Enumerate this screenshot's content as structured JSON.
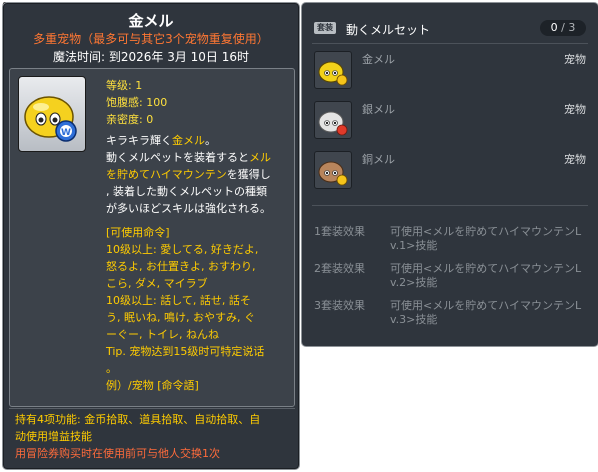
{
  "corner": {
    "id": "05002809",
    "tag": "新增"
  },
  "tooltip": {
    "title": "金メル",
    "subtitle": "多重宠物（最多可与其它3个宠物重复使用）",
    "expiry": "魔法时间: 到2026年 3月 10日 16时",
    "stats": {
      "level": "等级: 1",
      "fullness": "饱腹感: 100",
      "closeness": "亲密度: 0"
    },
    "desc_lines": [
      [
        "キラキラ輝く",
        "金メル",
        "。"
      ],
      [
        "動くメルペットを装着すると",
        "メル",
        ""
      ],
      [
        "を貯めてハイマウンテン",
        "",
        "を獲得し"
      ],
      [
        ", 装着した動くメルペットの種類",
        "",
        ""
      ],
      [
        "が多いほどスキルは強化される。",
        "",
        ""
      ]
    ],
    "commands": [
      "[可使用命令]",
      "10级以上: 愛してる, 好きだよ,",
      "怒るよ, お仕置きよ, おすわり,",
      "こら, ダメ, マイラブ",
      "10级以上: 話して, 話せ, 話そ",
      "う, 眠いね, 鳴け, おやすみ, ぐ",
      "ーぐー, トイレ, ねんね",
      "Tip. 宠物达到15级时可特定说话",
      "。",
      "例）/宠物 [命令語]"
    ],
    "footer": {
      "line1": "持有4项功能: 金币拾取、道具拾取、自动拾取、自",
      "line2": "动使用增益技能",
      "warn": "用冒险券购买时在使用前可与他人交换1次"
    }
  },
  "set_panel": {
    "badge": "套装",
    "title": "動くメルセット",
    "count_current": "0",
    "count_sep": " / ",
    "count_total": "3",
    "items": [
      {
        "name": "金メル",
        "type": "宠物",
        "color": "#f2d21a"
      },
      {
        "name": "銀メル",
        "type": "宠物",
        "color": "#e4e4e4"
      },
      {
        "name": "銅メル",
        "type": "宠物",
        "color": "#b8855c"
      }
    ],
    "effects": [
      {
        "label": "1套装效果",
        "line1": "可使用<メルを貯めてハイマウンテンL",
        "line2": "v.1>技能"
      },
      {
        "label": "2套装效果",
        "line1": "可使用<メルを貯めてハイマウンテンL",
        "line2": "v.2>技能"
      },
      {
        "label": "3套装效果",
        "line1": "可使用<メルを貯めてハイマウンテンL",
        "line2": "v.3>技能"
      }
    ]
  }
}
